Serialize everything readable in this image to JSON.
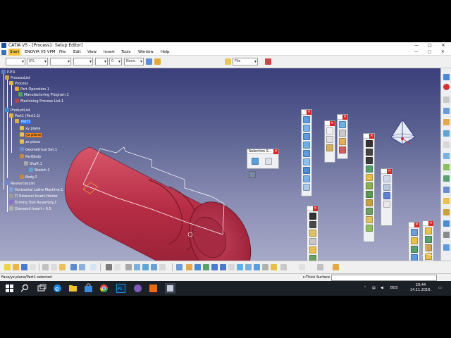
{
  "window": {
    "title": "CATIA V5 - [Process1: Setup Editor]",
    "controls": [
      "—",
      "□",
      "✕"
    ]
  },
  "menu": {
    "items": [
      "Start",
      "ENOVIA V5 VPM",
      "File",
      "Edit",
      "View",
      "Insert",
      "Tools",
      "Window",
      "Help"
    ],
    "doc_controls": [
      "—",
      "□",
      "✕"
    ]
  },
  "toolbar": {
    "combo_1": "",
    "combo_2": "0%",
    "combo_3": "",
    "combo_4": "",
    "combo_5": "",
    "combo_6": "0",
    "combo_7": "None",
    "combo_file": "File"
  },
  "tree": {
    "nodes": [
      {
        "label": "P.P.R.",
        "icon": "ppr-icon"
      },
      {
        "label": "ProcessList",
        "icon": "process-list-icon"
      },
      {
        "label": "Process",
        "icon": "process-icon"
      },
      {
        "label": "Part Operation.1",
        "icon": "part-operation-icon"
      },
      {
        "label": "Manufacturing Program.1",
        "icon": "manufacturing-program-icon"
      },
      {
        "label": "Machining Process List.1",
        "icon": "machining-process-list-icon"
      },
      {
        "label": "ProductList",
        "icon": "product-list-icon"
      },
      {
        "label": "Part1 (Part1.1)",
        "icon": "part-icon"
      },
      {
        "label": "Part1",
        "icon": "part-icon"
      },
      {
        "label": "xy plane",
        "icon": "plane-icon"
      },
      {
        "label": "yz plane",
        "icon": "plane-icon"
      },
      {
        "label": "zx plane",
        "icon": "plane-icon"
      },
      {
        "label": "Geometrical Set.1",
        "icon": "geometrical-set-icon"
      },
      {
        "label": "PartBody",
        "icon": "part-body-icon"
      },
      {
        "label": "Shaft.1",
        "icon": "shaft-icon"
      },
      {
        "label": "Sketch.1",
        "icon": "sketch-icon"
      },
      {
        "label": "Body.2",
        "icon": "body-icon"
      },
      {
        "label": "ResourcesList",
        "icon": "resources-list-icon"
      },
      {
        "label": "Horizontal Lathe Machine.1",
        "icon": "lathe-machine-icon"
      },
      {
        "label": "TI External Insert-Holder",
        "icon": "insert-holder-icon"
      },
      {
        "label": "Turning Tool Assembly.1",
        "icon": "tool-assembly-icon"
      },
      {
        "label": "Diamond Insert r 0.5",
        "icon": "diamond-insert-icon"
      }
    ]
  },
  "floating_toolbars": {
    "selection": {
      "title": "Selection S..."
    }
  },
  "status": {
    "message": "Face/yz plane/Part1 selected",
    "command_label": "c:Thick Surface",
    "command_value": ""
  },
  "taskbar": {
    "tray_text": "BOS",
    "time": "20:44",
    "date": "14.11.2016."
  },
  "colors": {
    "viewport_top": "#3b3f7b",
    "viewport_bottom": "#a7a9c8",
    "part": "#c9384f",
    "highlight": "#f08c1f",
    "taskbar": "#1b1f26"
  }
}
